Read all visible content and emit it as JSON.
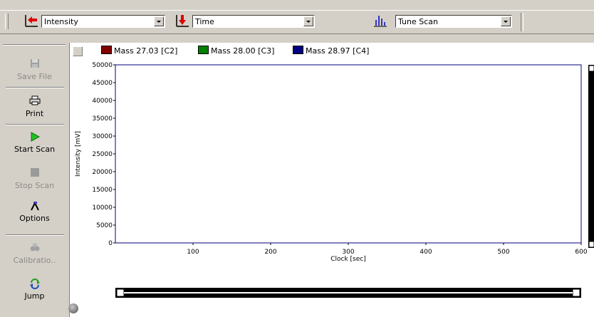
{
  "toolbar": {
    "y_axis_select": "Intensity",
    "x_axis_select": "Time",
    "scan_mode_select": "Tune Scan"
  },
  "sidebar": {
    "items": [
      {
        "label": "Save File",
        "icon": "floppy-icon",
        "enabled": false
      },
      {
        "label": "Print",
        "icon": "printer-icon",
        "enabled": true
      },
      {
        "label": "Start Scan",
        "icon": "play-icon",
        "enabled": true
      },
      {
        "label": "Stop Scan",
        "icon": "stop-icon",
        "enabled": false
      },
      {
        "label": "Options",
        "icon": "hammer-icon",
        "enabled": true
      },
      {
        "label": "Calibratio..",
        "icon": "calibration-icon",
        "enabled": false
      },
      {
        "label": "Jump",
        "icon": "jump-icon",
        "enabled": true
      }
    ]
  },
  "chart_data": {
    "type": "line",
    "title": "",
    "xlabel": "Clock [sec]",
    "ylabel": "Intensity [mV]",
    "xlim": [
      0,
      600
    ],
    "ylim": [
      0,
      50000
    ],
    "x_ticks": [
      100,
      200,
      300,
      400,
      500,
      600
    ],
    "y_ticks": [
      0,
      5000,
      10000,
      15000,
      20000,
      25000,
      30000,
      35000,
      40000,
      45000,
      50000
    ],
    "legend_placement": "top",
    "series": [
      {
        "name": "Mass  27.03 [C2]",
        "color": "#800000",
        "x": [],
        "y": []
      },
      {
        "name": "Mass  28.00 [C3]",
        "color": "#008000",
        "x": [],
        "y": []
      },
      {
        "name": "Mass  28.97 [C4]",
        "color": "#000080",
        "x": [],
        "y": []
      }
    ],
    "plot_border_color": "#000080"
  }
}
